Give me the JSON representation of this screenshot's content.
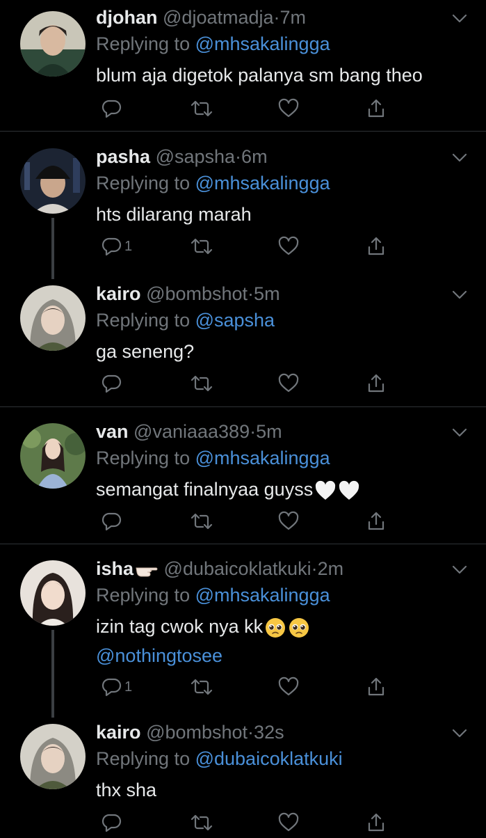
{
  "colors": {
    "background": "#000000",
    "text": "#e7e9ea",
    "muted": "#71767b",
    "link": "#4a90d9",
    "divider": "#2f3336"
  },
  "tweets": [
    {
      "name": "djohan",
      "handle": "@djoatmadja",
      "dot": "·",
      "time": "7m",
      "replying_prefix": "Replying to ",
      "replying_to": "@mhsakalingga",
      "text": "blum aja digetok palanya sm bang theo",
      "reply_count": ""
    },
    {
      "name": "pasha",
      "handle": "@sapsha",
      "dot": "·",
      "time": "6m",
      "replying_prefix": "Replying to ",
      "replying_to": "@mhsakalingga",
      "text": "hts dilarang marah",
      "reply_count": "1"
    },
    {
      "name": "kairo",
      "handle": "@bombshot",
      "dot": "·",
      "time": "5m",
      "replying_prefix": "Replying to ",
      "replying_to": "@sapsha",
      "text": "ga seneng?",
      "reply_count": ""
    },
    {
      "name": "van",
      "handle": "@vaniaaa389",
      "dot": "·",
      "time": "5m",
      "replying_prefix": "Replying to ",
      "replying_to": "@mhsakalingga",
      "text": "semangat finalnyaa guyss",
      "emojis": [
        "white-heart-emoji",
        "white-heart-emoji"
      ],
      "reply_count": ""
    },
    {
      "name": "isha",
      "name_emoji": "pointing-hand-emoji",
      "handle": "@dubaicoklatkuki",
      "dot": "·",
      "time": "2m",
      "replying_prefix": "Replying to ",
      "replying_to": "@mhsakalingga",
      "text": "izin tag cwok nya kk",
      "emojis": [
        "pleading-face-emoji",
        "pleading-face-emoji"
      ],
      "text_mention": "@nothingtosee",
      "reply_count": "1"
    },
    {
      "name": "kairo",
      "handle": "@bombshot",
      "dot": "·",
      "time": "32s",
      "replying_prefix": "Replying to ",
      "replying_to": "@dubaicoklatkuki",
      "text": "thx sha",
      "reply_count": ""
    }
  ],
  "icons": {
    "reply": "reply-icon",
    "retweet": "retweet-icon",
    "like": "like-icon",
    "share": "share-icon",
    "more": "chevron-down-icon"
  }
}
